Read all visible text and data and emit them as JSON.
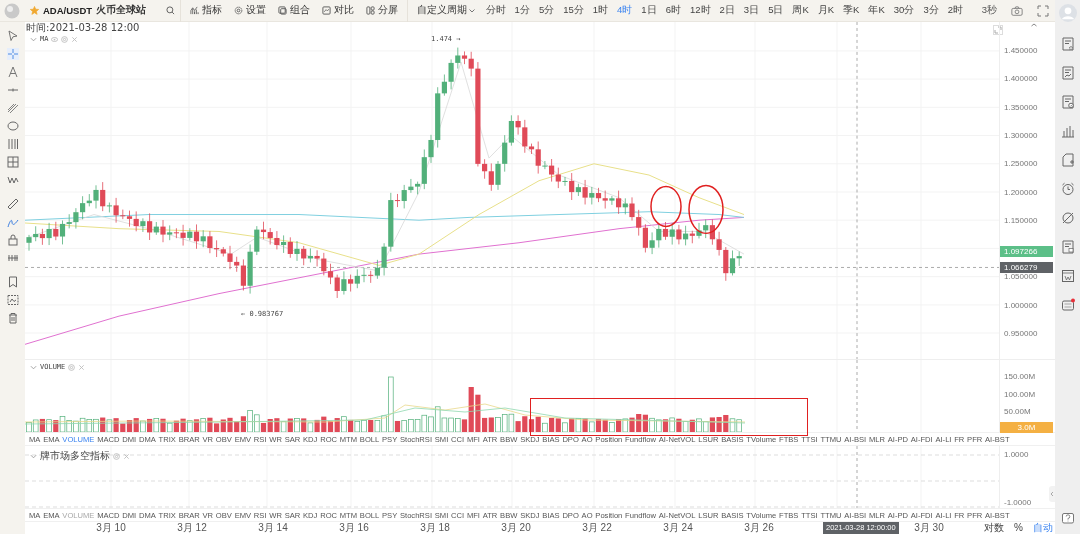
{
  "toolbar": {
    "symbol": "ADA/USDT",
    "favorite": true,
    "exchange": "火币全球站",
    "tools": [
      {
        "label": "指标",
        "kind": "indicator"
      },
      {
        "label": "设置",
        "kind": "settings"
      },
      {
        "label": "组合",
        "kind": "combo"
      },
      {
        "label": "对比",
        "kind": "compare"
      },
      {
        "label": "分屏",
        "kind": "split"
      }
    ],
    "period_menu": "自定义周期",
    "periods": [
      {
        "label": "分时",
        "selected": false
      },
      {
        "label": "1分",
        "selected": false
      },
      {
        "label": "5分",
        "selected": false
      },
      {
        "label": "15分",
        "selected": false
      },
      {
        "label": "1时",
        "selected": false
      },
      {
        "label": "4时",
        "selected": true
      },
      {
        "label": "1日",
        "selected": false
      },
      {
        "label": "6时",
        "selected": false
      },
      {
        "label": "12时",
        "selected": false
      },
      {
        "label": "2日",
        "selected": false
      },
      {
        "label": "3日",
        "selected": false
      },
      {
        "label": "5日",
        "selected": false
      },
      {
        "label": "周K",
        "selected": false
      },
      {
        "label": "月K",
        "selected": false
      },
      {
        "label": "季K",
        "selected": false
      },
      {
        "label": "年K",
        "selected": false
      },
      {
        "label": "30分",
        "selected": false
      },
      {
        "label": "3分",
        "selected": false
      },
      {
        "label": "2时",
        "selected": false
      }
    ],
    "refresh": "3秒"
  },
  "main_chart": {
    "time_label": "时间:2021-03-28 12:00",
    "legend": "MA",
    "high_label": "1.474 →",
    "low_label": "← 0.983767",
    "y_ticks": [
      "1.450000",
      "1.400000",
      "1.350000",
      "1.300000",
      "1.250000",
      "1.200000",
      "1.150000",
      "1.050000",
      "1.000000",
      "0.950000"
    ],
    "price_tags": [
      {
        "text": "1.097266",
        "kind": "last"
      },
      {
        "text": "1.066279",
        "kind": "cursor"
      }
    ]
  },
  "volume": {
    "legend": "VOLUME",
    "y_ticks": [
      "150.00M",
      "100.00M",
      "50.00M"
    ],
    "tag": "3.0M"
  },
  "indicator_tabs": [
    {
      "label": "MA",
      "selected": false
    },
    {
      "label": "EMA",
      "selected": false
    },
    {
      "label": "VOLUME",
      "selected": true
    },
    {
      "label": "MACD",
      "selected": false
    },
    {
      "label": "DMI",
      "selected": false
    },
    {
      "label": "DMA",
      "selected": false
    },
    {
      "label": "TRIX",
      "selected": false
    },
    {
      "label": "BRAR",
      "selected": false
    },
    {
      "label": "VR",
      "selected": false
    },
    {
      "label": "OBV",
      "selected": false
    },
    {
      "label": "EMV",
      "selected": false
    },
    {
      "label": "RSI",
      "selected": false
    },
    {
      "label": "WR",
      "selected": false
    },
    {
      "label": "SAR",
      "selected": false
    },
    {
      "label": "KDJ",
      "selected": false
    },
    {
      "label": "ROC",
      "selected": false
    },
    {
      "label": "MTM",
      "selected": false
    },
    {
      "label": "BOLL",
      "selected": false
    },
    {
      "label": "PSY",
      "selected": false
    },
    {
      "label": "StochRSI",
      "selected": false
    },
    {
      "label": "SMI",
      "selected": false
    },
    {
      "label": "CCI",
      "selected": false
    },
    {
      "label": "MFI",
      "selected": false
    },
    {
      "label": "ATR",
      "selected": false
    },
    {
      "label": "BBW",
      "selected": false
    },
    {
      "label": "SKDJ",
      "selected": false
    },
    {
      "label": "BIAS",
      "selected": false
    },
    {
      "label": "DPO",
      "selected": false
    },
    {
      "label": "AO",
      "selected": false
    },
    {
      "label": "Position",
      "selected": false
    },
    {
      "label": "Fundflow",
      "selected": false
    },
    {
      "label": "AI-NetVOL",
      "selected": false
    },
    {
      "label": "LSUR",
      "selected": false
    },
    {
      "label": "BASIS",
      "selected": false
    },
    {
      "label": "TVolume",
      "selected": false
    },
    {
      "label": "FTBS",
      "selected": false
    },
    {
      "label": "TTSI",
      "selected": false
    },
    {
      "label": "TTMU",
      "selected": false
    },
    {
      "label": "AI-BSI",
      "selected": false
    },
    {
      "label": "MLR",
      "selected": false
    },
    {
      "label": "AI-PD",
      "selected": false
    },
    {
      "label": "AI-FDI",
      "selected": false
    },
    {
      "label": "AI-LI",
      "selected": false
    },
    {
      "label": "FR",
      "selected": false
    },
    {
      "label": "PFR",
      "selected": false
    },
    {
      "label": "AI-BST",
      "selected": false
    }
  ],
  "sub_panel": {
    "legend": "牌市场多空指标",
    "y_ticks": [
      "1.0000",
      "-1.0000"
    ]
  },
  "indicator_tabs_2": [
    {
      "label": "MA",
      "disabled": false
    },
    {
      "label": "EMA",
      "disabled": false
    },
    {
      "label": "VOLUME",
      "disabled": true
    },
    {
      "label": "MACD",
      "disabled": false
    },
    {
      "label": "DMI",
      "disabled": false
    },
    {
      "label": "DMA",
      "disabled": false
    },
    {
      "label": "TRIX",
      "disabled": false
    },
    {
      "label": "BRAR",
      "disabled": false
    },
    {
      "label": "VR",
      "disabled": false
    },
    {
      "label": "OBV",
      "disabled": false
    },
    {
      "label": "EMV",
      "disabled": false
    },
    {
      "label": "RSI",
      "disabled": false
    },
    {
      "label": "WR",
      "disabled": false
    },
    {
      "label": "SAR",
      "disabled": false
    },
    {
      "label": "KDJ",
      "disabled": false
    },
    {
      "label": "ROC",
      "disabled": false
    },
    {
      "label": "MTM",
      "disabled": false
    },
    {
      "label": "BOLL",
      "disabled": false
    },
    {
      "label": "PSY",
      "disabled": false
    },
    {
      "label": "StochRSI",
      "disabled": false
    },
    {
      "label": "SMI",
      "disabled": false
    },
    {
      "label": "CCI",
      "disabled": false
    },
    {
      "label": "MFI",
      "disabled": false
    },
    {
      "label": "ATR",
      "disabled": false
    },
    {
      "label": "BBW",
      "disabled": false
    },
    {
      "label": "SKDJ",
      "disabled": false
    },
    {
      "label": "BIAS",
      "disabled": false
    },
    {
      "label": "DPO",
      "disabled": false
    },
    {
      "label": "AO",
      "disabled": false
    },
    {
      "label": "Position",
      "disabled": false
    },
    {
      "label": "Fundflow",
      "disabled": false
    },
    {
      "label": "AI-NetVOL",
      "disabled": false
    },
    {
      "label": "LSUR",
      "disabled": false
    },
    {
      "label": "BASIS",
      "disabled": false
    },
    {
      "label": "TVolume",
      "disabled": false
    },
    {
      "label": "FTBS",
      "disabled": false
    },
    {
      "label": "TTSI",
      "disabled": false
    },
    {
      "label": "TTMU",
      "disabled": false
    },
    {
      "label": "AI-BSI",
      "disabled": false
    },
    {
      "label": "MLR",
      "disabled": false
    },
    {
      "label": "AI-PD",
      "disabled": false
    },
    {
      "label": "AI-FDI",
      "disabled": false
    },
    {
      "label": "AI-LI",
      "disabled": false
    },
    {
      "label": "FR",
      "disabled": false
    },
    {
      "label": "PFR",
      "disabled": false
    },
    {
      "label": "AI-BST",
      "disabled": false
    }
  ],
  "time_axis": {
    "labels": [
      "3月 10",
      "3月 12",
      "3月 14",
      "3月 16",
      "3月 18",
      "3月 20",
      "3月 22",
      "3月 24",
      "3月 26",
      "3月 30"
    ],
    "cursor_label": "2021-03-28 12:00:00",
    "options": [
      {
        "label": "对数",
        "selected": false
      },
      {
        "label": "%",
        "selected": false
      },
      {
        "label": "自动",
        "selected": true
      }
    ]
  }
}
